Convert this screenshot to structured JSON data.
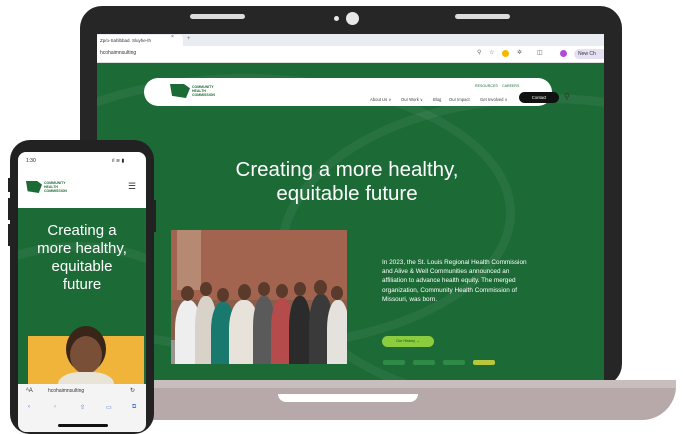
{
  "browser": {
    "tab_title": "Zp/o-Sahlbbad. Sluyhe-Ih",
    "tab_close": "×",
    "tab_new": "+",
    "url": "hcohaimnsulting",
    "new_chrome": "New Ch"
  },
  "site": {
    "logo_lines": [
      "COMMUNITY",
      "HEALTH",
      "COMMISSION"
    ],
    "top_links": [
      "RESOURCES",
      "CAREERS"
    ],
    "nav": [
      "About Us ∨",
      "Our Work ∨",
      "Blog",
      "Our Impact",
      "Get Involved ∨"
    ],
    "contact_label": "Contact",
    "hero_title_line1": "Creating a more healthy,",
    "hero_title_line2": "equitable future",
    "paragraph": "In 2023, the St. Louis Regional Health Commission and Alive & Well Communities announced an affiliation to advance health equity. The merged organization, Community Health Commission of Missouri, was born.",
    "history_button": "Our History →"
  },
  "phone": {
    "time": "1:30",
    "status_icons": "ıl ≋ ▮",
    "logo_lines": [
      "COMMUNITY",
      "HEALTH",
      "COMMISSION"
    ],
    "menu_icon": "☰",
    "hero_line1": "Creating a",
    "hero_line2": "more healthy,",
    "hero_line3": "equitable",
    "hero_line4": "future",
    "url": "hcohaimnsulting",
    "reload_icon": "↻",
    "aa_label": "ᴬA"
  },
  "colors": {
    "brand_green": "#1c6b36",
    "accent_lime": "#8ccd3f",
    "accent_yellow": "#f0b43a"
  }
}
